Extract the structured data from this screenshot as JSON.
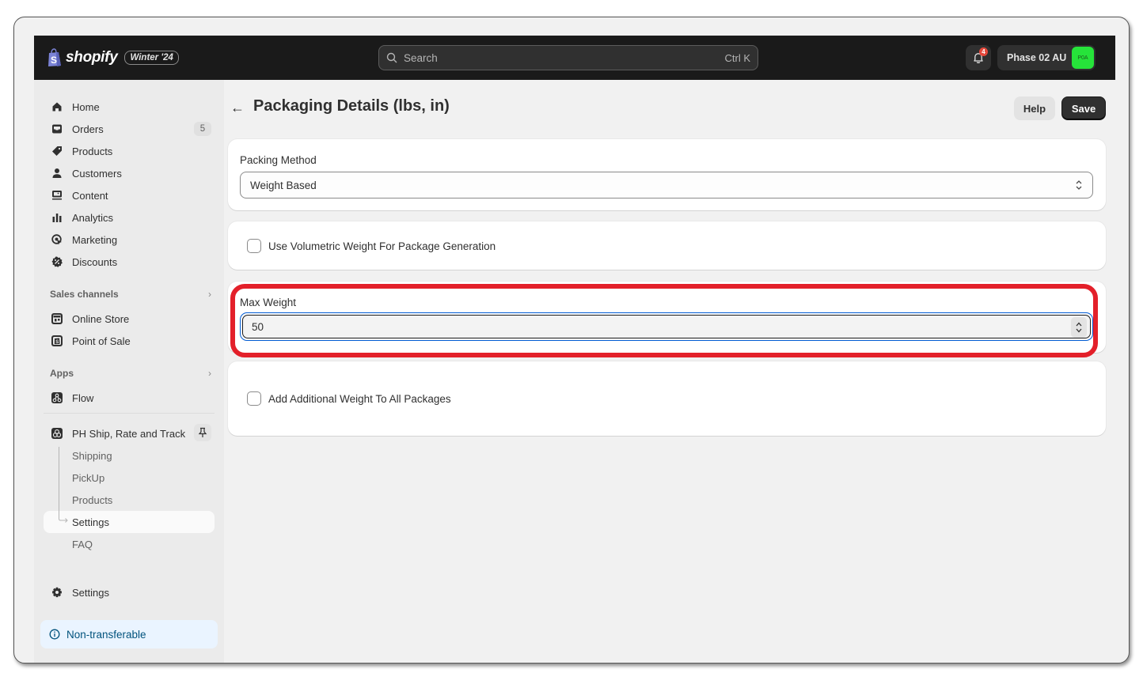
{
  "topbar": {
    "brand": "shopify",
    "edition_badge": "Winter '24",
    "search_placeholder": "Search",
    "search_shortcut": "Ctrl K",
    "notification_count": "4",
    "store_name": "Phase 02 AU",
    "store_avatar_initials": "P0A",
    "store_avatar_color": "#26e33a"
  },
  "sidebar": {
    "main_items": [
      {
        "label": "Home",
        "icon": "home-icon"
      },
      {
        "label": "Orders",
        "icon": "inbox-icon",
        "count": "5"
      },
      {
        "label": "Products",
        "icon": "tag-icon"
      },
      {
        "label": "Customers",
        "icon": "person-icon"
      },
      {
        "label": "Content",
        "icon": "content-icon"
      },
      {
        "label": "Analytics",
        "icon": "bar-chart-icon"
      },
      {
        "label": "Marketing",
        "icon": "target-icon"
      },
      {
        "label": "Discounts",
        "icon": "discount-icon"
      }
    ],
    "sales_channels_heading": "Sales channels",
    "sales_channels": [
      {
        "label": "Online Store",
        "icon": "store-icon"
      },
      {
        "label": "Point of Sale",
        "icon": "pos-icon"
      }
    ],
    "apps_heading": "Apps",
    "apps": [
      {
        "label": "Flow",
        "icon": "flow-icon"
      }
    ],
    "pinned_app": {
      "label": "PH Ship, Rate and Track",
      "sub_items": [
        {
          "label": "Shipping"
        },
        {
          "label": "PickUp"
        },
        {
          "label": "Products"
        },
        {
          "label": "Settings",
          "active": true
        },
        {
          "label": "FAQ"
        }
      ]
    },
    "settings_label": "Settings",
    "non_transferable_label": "Non-transferable"
  },
  "page": {
    "title": "Packaging Details (lbs, in)",
    "help_label": "Help",
    "save_label": "Save",
    "packing_method": {
      "label": "Packing Method",
      "selected": "Weight Based"
    },
    "volumetric_checkbox": {
      "label": "Use Volumetric Weight For Package Generation",
      "checked": false
    },
    "max_weight": {
      "label": "Max Weight",
      "value": "50"
    },
    "additional_weight_checkbox": {
      "label": "Add Additional Weight To All Packages",
      "checked": false
    },
    "highlight_color": "#e3202a"
  }
}
